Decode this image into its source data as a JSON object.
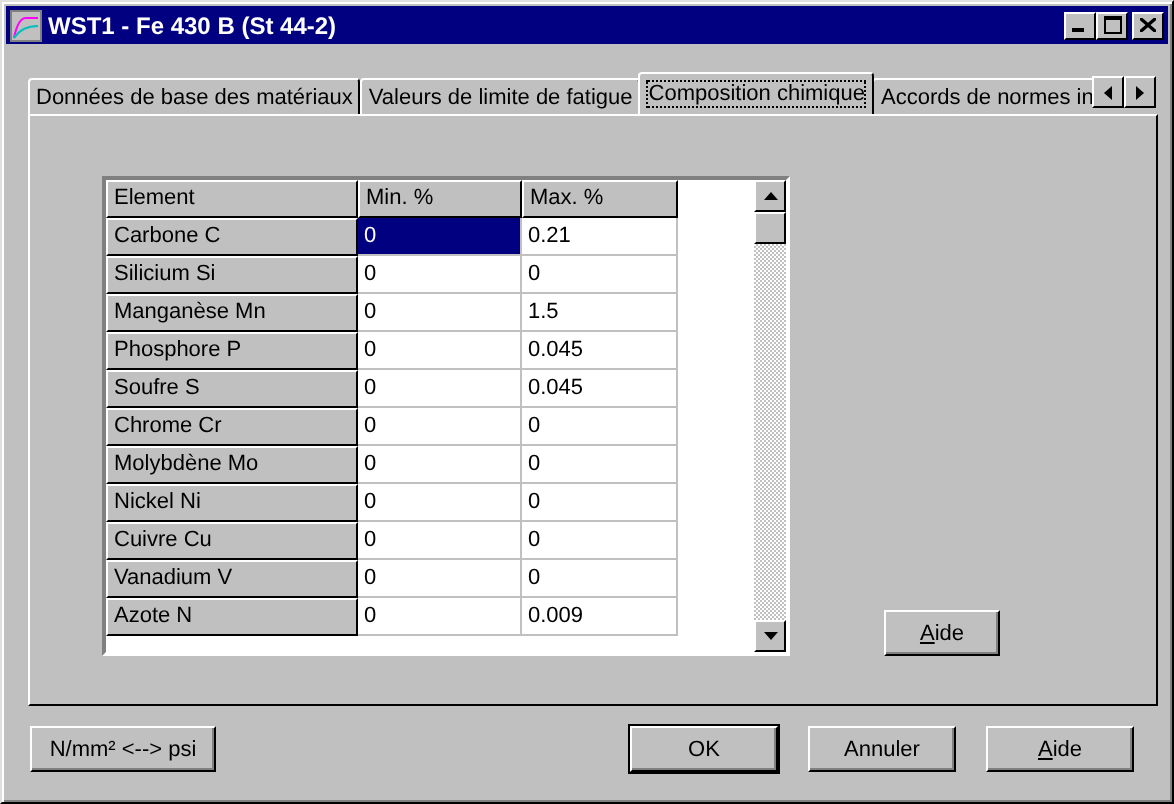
{
  "window": {
    "title": "WST1 - Fe 430 B (St 44-2)"
  },
  "tabs": [
    {
      "label": "Données de base des matériaux",
      "selected": false
    },
    {
      "label": "Valeurs de limite de fatigue",
      "selected": false
    },
    {
      "label": "Composition chimique",
      "selected": true
    },
    {
      "label": "Accords de normes in",
      "selected": false
    }
  ],
  "table": {
    "columns": [
      "Element",
      "Min. %",
      "Max. %"
    ],
    "rows": [
      {
        "element": "Carbone C",
        "min": "0",
        "max": "0.21",
        "selected": true
      },
      {
        "element": "Silicium Si",
        "min": "0",
        "max": "0",
        "selected": false
      },
      {
        "element": "Manganèse Mn",
        "min": "0",
        "max": "1.5",
        "selected": false
      },
      {
        "element": "Phosphore P",
        "min": "0",
        "max": "0.045",
        "selected": false
      },
      {
        "element": "Soufre S",
        "min": "0",
        "max": "0.045",
        "selected": false
      },
      {
        "element": "Chrome Cr",
        "min": "0",
        "max": "0",
        "selected": false
      },
      {
        "element": "Molybdène Mo",
        "min": "0",
        "max": "0",
        "selected": false
      },
      {
        "element": "Nickel Ni",
        "min": "0",
        "max": "0",
        "selected": false
      },
      {
        "element": "Cuivre Cu",
        "min": "0",
        "max": "0",
        "selected": false
      },
      {
        "element": "Vanadium V",
        "min": "0",
        "max": "0",
        "selected": false
      },
      {
        "element": "Azote N",
        "min": "0",
        "max": "0.009",
        "selected": false
      }
    ]
  },
  "panel_button": {
    "label": "Aide",
    "mnemonic": true
  },
  "buttons": [
    {
      "label": "N/mm² <--> psi",
      "mnemonic": false,
      "default": false
    },
    {
      "label": "OK",
      "mnemonic": false,
      "default": true
    },
    {
      "label": "Annuler",
      "mnemonic": false,
      "default": false
    },
    {
      "label": "Aide",
      "mnemonic": true,
      "default": false
    }
  ]
}
